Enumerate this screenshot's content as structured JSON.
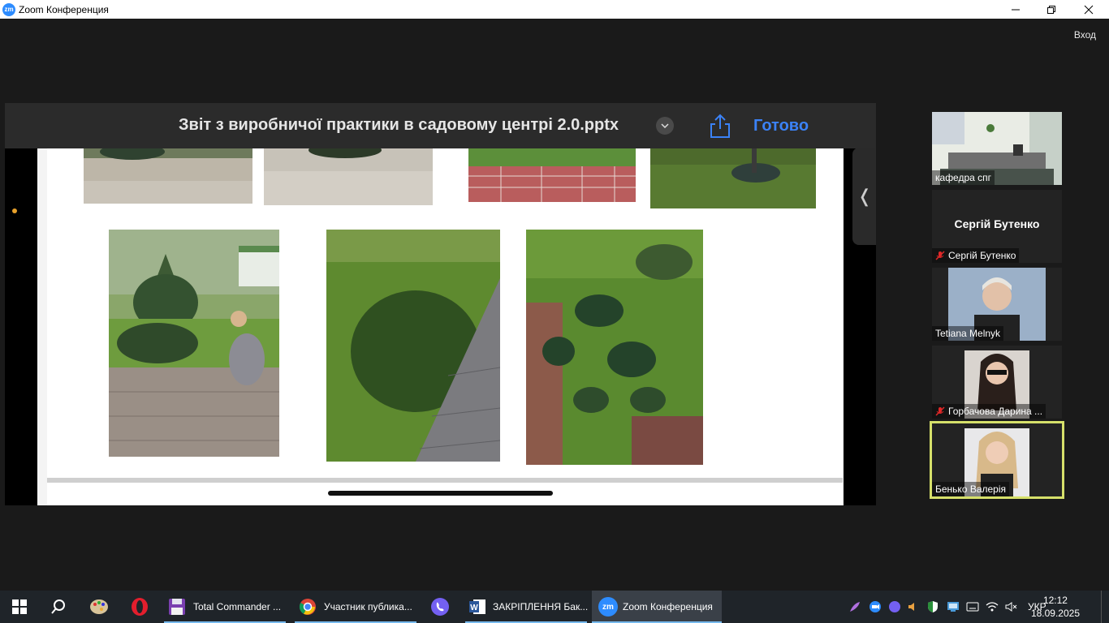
{
  "window": {
    "app_logo": "zm",
    "title": "Zoom Конференция",
    "minimize_icon": "minimize-icon",
    "restore_icon": "restore-icon",
    "close_icon": "close-icon"
  },
  "header": {
    "signin_label": "Вход"
  },
  "share": {
    "filename": "Звіт з виробничої практики в садовому центрі 2.0.pptx",
    "done_label": "Готово",
    "side_tab_glyph": "❬"
  },
  "participants": [
    {
      "name": "кафедра спг",
      "muted": false,
      "video": true
    },
    {
      "name": "Сергій Бутенко",
      "display_name": "Сергій Бутенко",
      "muted": true,
      "video": false
    },
    {
      "name": "Tetiana Melnyk",
      "muted": false,
      "video": true
    },
    {
      "name": "Горбачова Дарина ...",
      "muted": true,
      "video": true
    },
    {
      "name": "Бенько Валерія",
      "muted": false,
      "video": true,
      "active_speaker": true
    }
  ],
  "taskbar": {
    "apps": [
      {
        "label": "Total Commander ...",
        "icon": "floppy-icon"
      },
      {
        "label": "Участник публика...",
        "icon": "chrome-icon"
      },
      {
        "label": "ЗАКРІПЛЕННЯ Бак...",
        "icon": "word-icon"
      },
      {
        "label": "Zoom Конференция",
        "icon": "zoom-icon",
        "active": true
      }
    ],
    "language": "УКР",
    "time": "12:12",
    "date": "18.09.2025"
  },
  "colors": {
    "accent": "#2d8cff",
    "done_blue": "#3b82f6",
    "active_speaker_border": "#d6e06a",
    "taskbar_bg": "#1f2429"
  }
}
